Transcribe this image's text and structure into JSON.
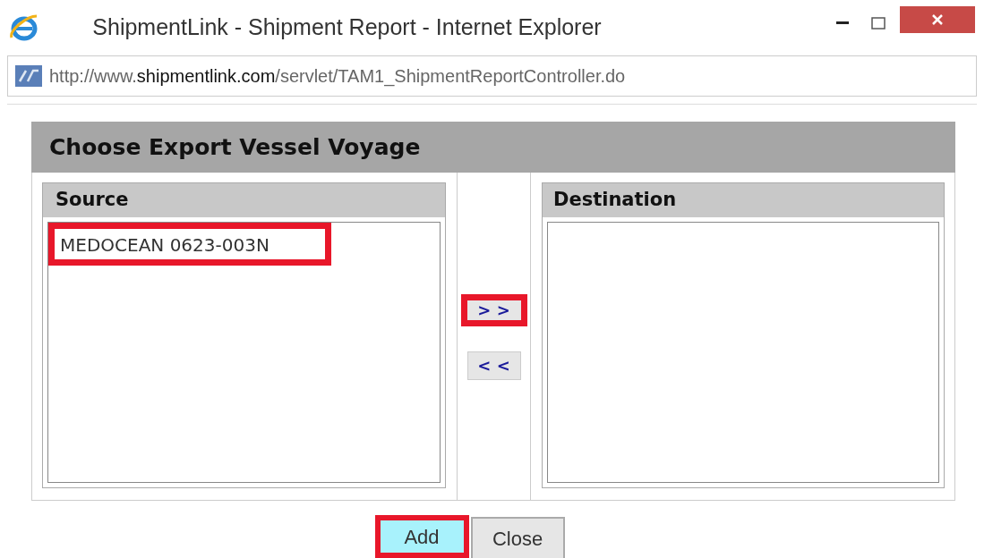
{
  "window": {
    "title": "ShipmentLink - Shipment Report - Internet Explorer"
  },
  "address_bar": {
    "prefix": "http://www.",
    "domain": "shipmentlink.com",
    "path": "/servlet/TAM1_ShipmentReportController.do"
  },
  "dialog": {
    "title": "Choose Export Vessel Voyage",
    "source": {
      "title": "Source",
      "items": [
        {
          "label": "MEDOCEAN 0623-003N",
          "highlighted": true
        }
      ]
    },
    "move_buttons": [
      {
        "label": "> >",
        "highlighted": true
      },
      {
        "label": "< <",
        "highlighted": false
      }
    ],
    "destination": {
      "title": "Destination"
    }
  },
  "buttons": [
    {
      "label": "Add",
      "focused": true,
      "highlighted": true
    },
    {
      "label": "Close",
      "focused": false,
      "highlighted": false
    }
  ]
}
